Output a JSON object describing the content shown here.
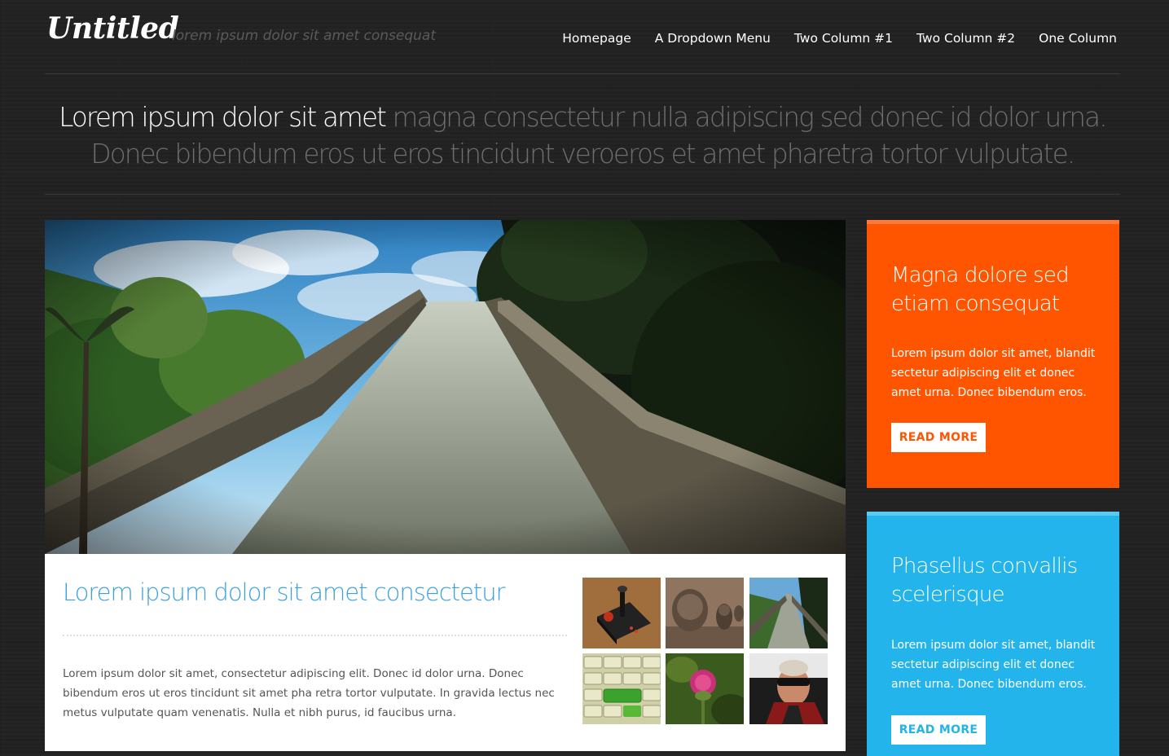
{
  "header": {
    "logo": "Untitled",
    "tagline": "lorem ipsum dolor sit amet consequat",
    "nav": [
      "Homepage",
      "A Dropdown Menu",
      "Two Column #1",
      "Two Column #2",
      "One Column"
    ]
  },
  "banner": {
    "highlight": "Lorem ipsum dolor sit amet",
    "text": "magna consectetur nulla adipiscing sed donec id dolor urna. Donec bibendum eros ut eros tincidunt veroeros et amet pharetra tortor vulputate."
  },
  "main": {
    "hero_image": "stone-bridge-path-photo",
    "post_title": "Lorem ipsum dolor sit amet consectetur",
    "post_text": "Lorem ipsum dolor sit amet, consectetur adipiscing elit. Donec id dolor urna. Donec bibendum eros ut eros tincidunt sit amet pha retra tortor vulputate. In gravida lectus nec metus vulputate quam venenatis. Nulla et nibh purus, id faucibus urna.",
    "thumbnails": [
      "joystick-photo",
      "stone-statues-photo",
      "bridge-path-photo",
      "keyboard-photo",
      "thistle-flower-photo",
      "man-sunglasses-photo"
    ]
  },
  "sidebar": {
    "boxes": [
      {
        "title": "Magna dolore sed etiam consequat",
        "text": "Lorem ipsum dolor sit amet, blandit sectetur adipiscing elit et donec amet urna. Donec bibendum eros.",
        "button": "READ MORE",
        "color": "#ff5500"
      },
      {
        "title": "Phasellus convallis scelerisque",
        "text": "Lorem ipsum dolor sit amet, blandit sectetur adipiscing elit et donec amet urna. Donec bibendum eros.",
        "button": "READ MORE",
        "color": "#22b4ea"
      }
    ]
  }
}
